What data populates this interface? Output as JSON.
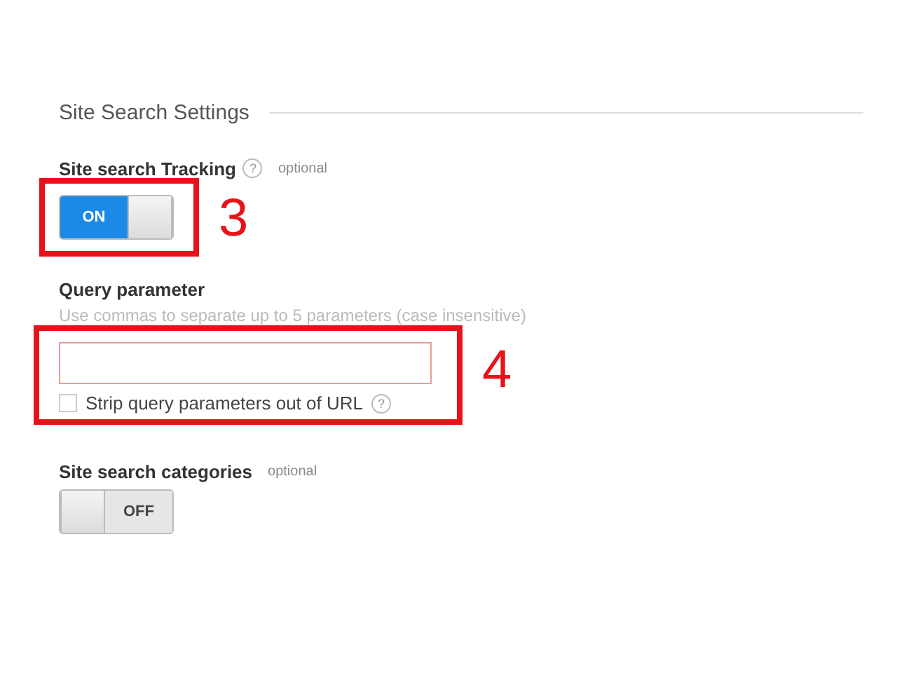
{
  "section": {
    "title": "Site Search Settings"
  },
  "fields": [
    {
      "kind": "toggle",
      "label": "Site search Tracking",
      "help": "?",
      "optional": "optional",
      "on": true,
      "toggle_text": "ON",
      "annotation": "3"
    },
    {
      "kind": "text",
      "label": "Query parameter",
      "hint": "Use commas to separate up to 5 parameters (case insensitive)",
      "checkbox": {
        "label": "Strip query parameters out of URL",
        "checked": false,
        "help": "?"
      },
      "annotation": "4"
    },
    {
      "kind": "toggle",
      "label": "Site search categories",
      "optional": "optional",
      "on": false,
      "toggle_text": "OFF"
    }
  ]
}
